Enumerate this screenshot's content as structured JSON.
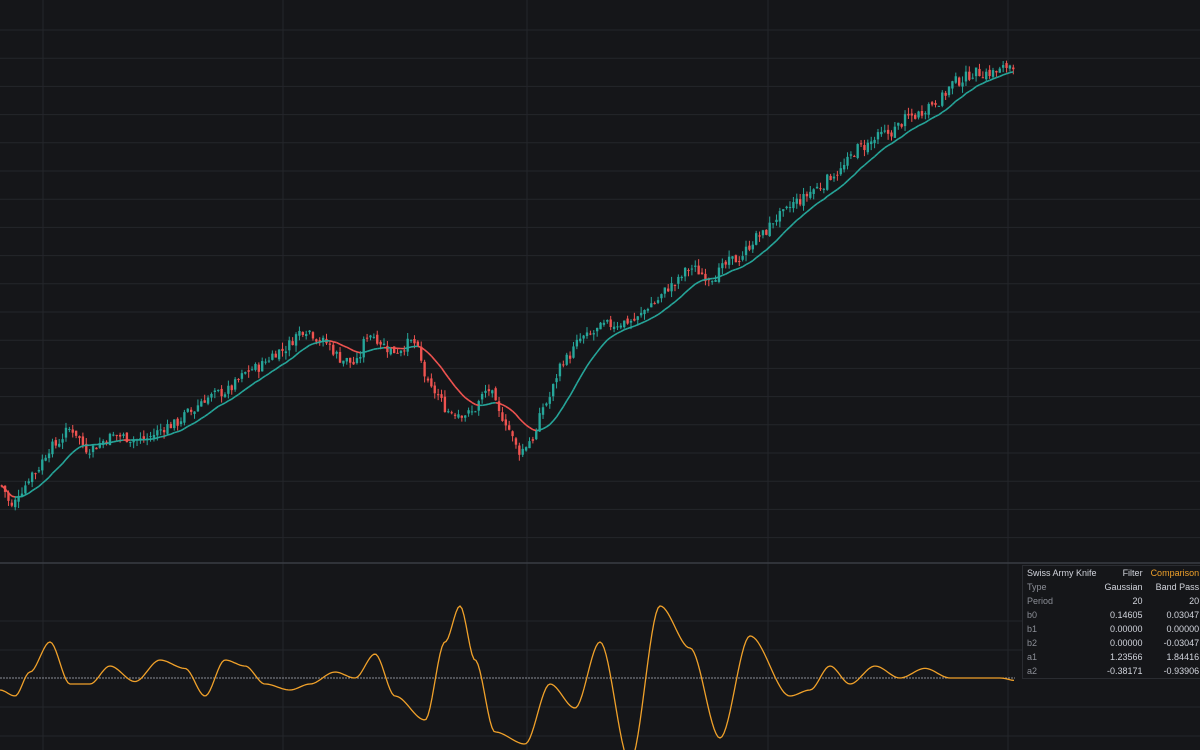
{
  "colors": {
    "background": "#151619",
    "grid": "#24262b",
    "up_candle": "#26a69a",
    "down_candle": "#ef5350",
    "oscillator": "#f0a12a",
    "zero_line": "#8b8e96",
    "separator": "#3a3d44"
  },
  "info_table": {
    "title": "Swiss Army Knife",
    "col_filter": "Filter",
    "col_comparison": "Comparison",
    "rows": [
      {
        "label": "Type",
        "filter": "Gaussian",
        "comparison": "Band Pass"
      },
      {
        "label": "Period",
        "filter": "20",
        "comparison": "20"
      },
      {
        "label": "b0",
        "filter": "0.14605",
        "comparison": "0.03047"
      },
      {
        "label": "b1",
        "filter": "0.00000",
        "comparison": "0.00000"
      },
      {
        "label": "b2",
        "filter": "0.00000",
        "comparison": "-0.03047"
      },
      {
        "label": "a1",
        "filter": "1.23566",
        "comparison": "1.84416"
      },
      {
        "label": "a2",
        "filter": "-0.38171",
        "comparison": "-0.93906"
      }
    ]
  },
  "chart_data": [
    {
      "type": "candlestick",
      "title": "",
      "grid": true,
      "ylim": [
        0,
        100
      ],
      "price_anchors": [
        [
          0,
          20
        ],
        [
          8,
          10
        ],
        [
          15,
          18
        ],
        [
          25,
          26
        ],
        [
          40,
          38
        ],
        [
          55,
          46
        ],
        [
          68,
          37
        ],
        [
          90,
          43
        ],
        [
          110,
          41
        ],
        [
          135,
          48
        ],
        [
          150,
          54
        ],
        [
          160,
          60
        ],
        [
          175,
          63
        ],
        [
          200,
          74
        ],
        [
          220,
          82
        ],
        [
          240,
          92
        ],
        [
          255,
          86
        ],
        [
          270,
          78
        ],
        [
          280,
          76
        ],
        [
          290,
          90
        ],
        [
          310,
          82
        ],
        [
          325,
          86
        ],
        [
          340,
          64
        ],
        [
          355,
          54
        ],
        [
          370,
          53
        ],
        [
          385,
          64
        ],
        [
          395,
          52
        ],
        [
          410,
          36
        ],
        [
          420,
          42
        ],
        [
          430,
          58
        ],
        [
          445,
          78
        ],
        [
          460,
          88
        ],
        [
          480,
          94
        ],
        [
          500,
          96
        ],
        [
          515,
          104
        ],
        [
          530,
          112
        ],
        [
          545,
          120
        ],
        [
          560,
          116
        ],
        [
          580,
          124
        ],
        [
          600,
          135
        ],
        [
          615,
          144
        ],
        [
          630,
          151
        ],
        [
          645,
          157
        ],
        [
          660,
          164
        ],
        [
          680,
          176
        ],
        [
          700,
          182
        ],
        [
          720,
          190
        ],
        [
          740,
          197
        ],
        [
          755,
          206
        ],
        [
          770,
          210
        ],
        [
          785,
          210
        ],
        [
          800,
          214
        ]
      ],
      "moving_average": {
        "type": "Gaussian",
        "period": 20
      }
    },
    {
      "type": "line",
      "title": "",
      "zero_line": true,
      "series": [
        {
          "values_anchors": [
            [
              0,
              -10
            ],
            [
              15,
              -15
            ],
            [
              30,
              5
            ],
            [
              50,
              30
            ],
            [
              70,
              -5
            ],
            [
              90,
              -5
            ],
            [
              110,
              10
            ],
            [
              135,
              -3
            ],
            [
              160,
              15
            ],
            [
              185,
              8
            ],
            [
              205,
              -15
            ],
            [
              225,
              15
            ],
            [
              245,
              10
            ],
            [
              265,
              -5
            ],
            [
              290,
              -10
            ],
            [
              310,
              -5
            ],
            [
              335,
              5
            ],
            [
              355,
              0
            ],
            [
              375,
              20
            ],
            [
              395,
              -15
            ],
            [
              425,
              -35
            ],
            [
              445,
              30
            ],
            [
              460,
              60
            ],
            [
              475,
              15
            ],
            [
              495,
              -45
            ],
            [
              525,
              -55
            ],
            [
              550,
              -5
            ],
            [
              575,
              -25
            ],
            [
              600,
              30
            ],
            [
              630,
              -70
            ],
            [
              660,
              60
            ],
            [
              690,
              25
            ],
            [
              720,
              -50
            ],
            [
              750,
              35
            ],
            [
              790,
              -15
            ],
            [
              810,
              -10
            ],
            [
              830,
              10
            ],
            [
              850,
              -5
            ],
            [
              875,
              10
            ],
            [
              900,
              0
            ],
            [
              925,
              8
            ],
            [
              950,
              0
            ],
            [
              975,
              0
            ],
            [
              1000,
              0
            ],
            [
              1015,
              -2
            ]
          ]
        }
      ]
    }
  ]
}
